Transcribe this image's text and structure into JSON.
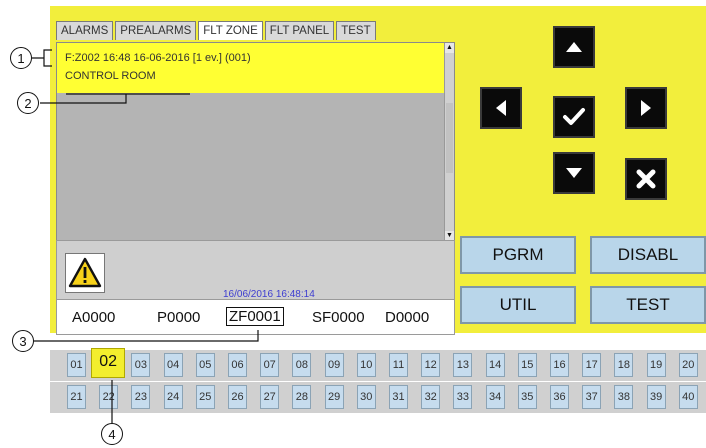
{
  "tabs": [
    "ALARMS",
    "PREALARMS",
    "FLT ZONE",
    "FLT PANEL",
    "TEST"
  ],
  "active_tab_index": 2,
  "event": {
    "line": "F:Z002 16:48 16-06-2016 [1 ev.] (001)",
    "zone_name": "CONTROL ROOM"
  },
  "status": {
    "warning_icon": "warning-triangle-icon",
    "datetime": "16/06/2016 16:48:14"
  },
  "counters": {
    "alarms": "A0000",
    "prealarms": "P0000",
    "fault_zone": "ZF0001",
    "system_fault": "SF0000",
    "disabled": "D0000"
  },
  "nav": {
    "up_icon": "arrow-up-icon",
    "left_icon": "arrow-left-icon",
    "confirm_icon": "checkmark-icon",
    "right_icon": "arrow-right-icon",
    "down_icon": "arrow-down-icon",
    "cancel_icon": "cancel-x-icon"
  },
  "function_buttons": {
    "pgrm": "PGRM",
    "disabl": "DISABL",
    "util": "UTIL",
    "test": "TEST"
  },
  "zones_row1": [
    "01",
    "02",
    "03",
    "04",
    "05",
    "06",
    "07",
    "08",
    "09",
    "10",
    "11",
    "12",
    "13",
    "14",
    "15",
    "16",
    "17",
    "18",
    "19",
    "20"
  ],
  "zones_row2": [
    "21",
    "22",
    "23",
    "24",
    "25",
    "26",
    "27",
    "28",
    "29",
    "30",
    "31",
    "32",
    "33",
    "34",
    "35",
    "36",
    "37",
    "38",
    "39",
    "40"
  ],
  "selected_zone": "02",
  "callouts": [
    "1",
    "2",
    "3",
    "4"
  ],
  "colors": {
    "panel_yellow": "#f2ee3c",
    "selected_event": "#ffff33",
    "button_blue": "#b9d6ea",
    "datetime_blue": "#3d3dd0"
  }
}
